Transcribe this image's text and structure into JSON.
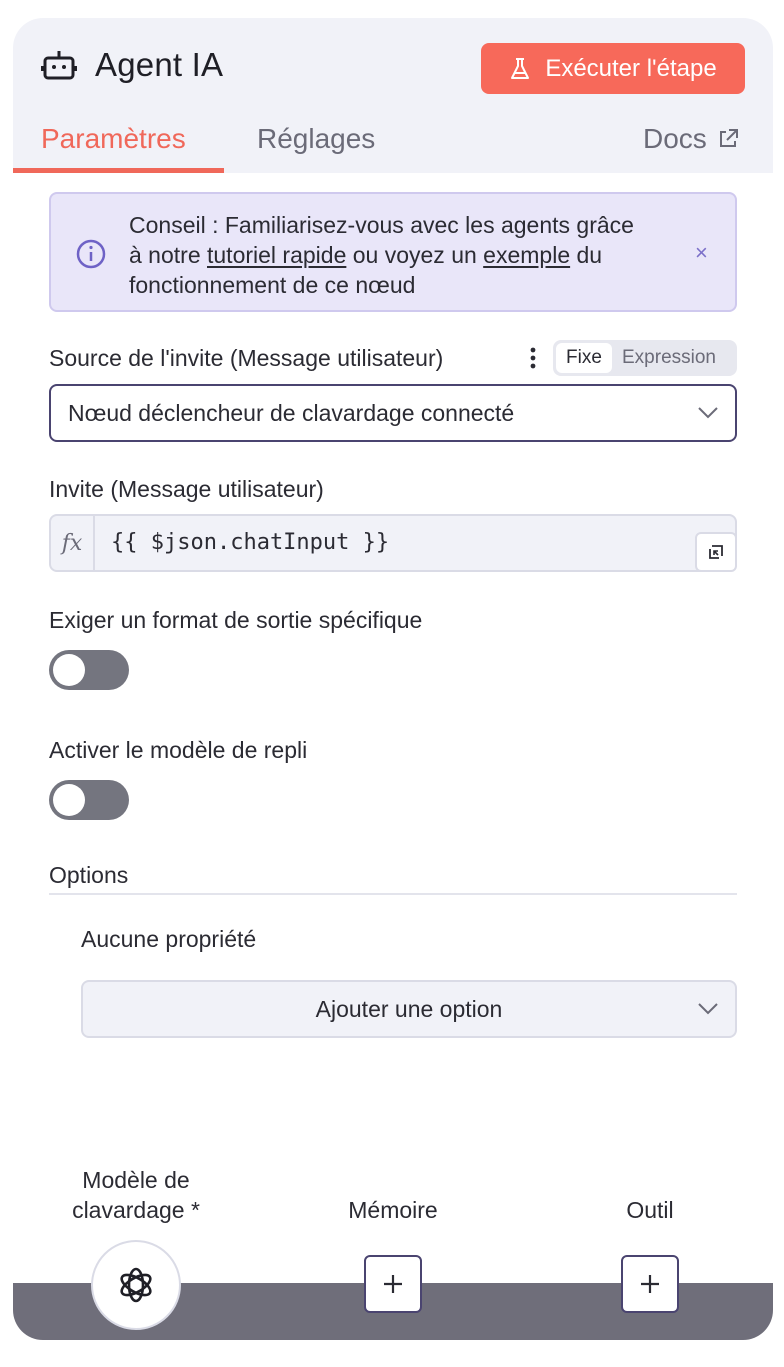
{
  "header": {
    "title": "Agent IA",
    "run_button": "Exécuter l'étape",
    "icons": {
      "node": "robot-icon",
      "run": "flask-icon",
      "docs": "external-link-icon"
    }
  },
  "tabs": [
    {
      "label": "Paramètres",
      "active": true
    },
    {
      "label": "Réglages",
      "active": false
    },
    {
      "label": "Docs",
      "active": false
    }
  ],
  "tip": {
    "line1": "Conseil : Familiarisez-vous avec les agents grâce",
    "line2_a": "à notre ",
    "line2_link1": "tutoriel rapide",
    "line2_b": " ou voyez un ",
    "line2_link2": "exemple",
    "line2_c": " du",
    "line3": "fonctionnement de ce nœud",
    "close": "×"
  },
  "prompt_source": {
    "label": "Source de l'invite (Message utilisateur)",
    "mode_fixed": "Fixe",
    "mode_expression": "Expression",
    "selected": "Nœud déclencheur de clavardage connecté"
  },
  "prompt": {
    "label": "Invite (Message utilisateur)",
    "fx": "fx",
    "value": "{{ $json.chatInput }}"
  },
  "output_format": {
    "label": "Exiger un format de sortie spécifique",
    "enabled": false
  },
  "fallback_model": {
    "label": "Activer le modèle de repli",
    "enabled": false
  },
  "options": {
    "label": "Options",
    "empty": "Aucune propriété",
    "add_button": "Ajouter une option"
  },
  "connectors": {
    "model_line1": "Modèle de",
    "model_line2": "clavardage *",
    "memory": "Mémoire",
    "tool": "Outil"
  },
  "colors": {
    "accent": "#f7695a",
    "tip_bg": "#e9e6f9",
    "toggle_off": "#74757f"
  }
}
